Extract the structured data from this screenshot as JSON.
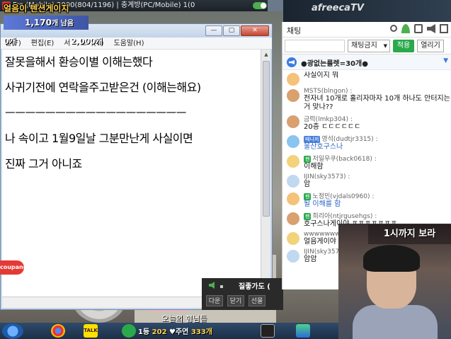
{
  "topbar": {
    "title_text": "Fre  (Mobile) 2000(804/1196) | 충계방(PC/Mobile) 1(0"
  },
  "overlay": {
    "title": "얼음이 텐션게이지",
    "count_main": "1,170",
    "count_suffix": "개 남음",
    "zero_label": "0개",
    "two_thousand_label": "2,000개"
  },
  "notepad": {
    "menu": [
      "일(F)",
      "편집(E)",
      "서",
      "보기(V)",
      "도움말(H)"
    ],
    "lines": [
      "잘못을해서 환승이별 이해는했다",
      "사귀기전에 연락을주고받은건 (이해는해요)",
      "ㅡㅡㅡㅡㅡㅡㅡㅡㅡㅡㅡㅡㅡㅡㅡㅡㅡㅡ",
      "나 속이고 1월9일날 그분만난게 사실이면",
      "진짜 그거 아니죠"
    ],
    "buttons": {
      "minimize": "—",
      "maximize": "▢",
      "close": "✕"
    }
  },
  "coupang": {
    "label": "coupang"
  },
  "player": {
    "quality_label": "질좋가도 (",
    "buttons": [
      "다운",
      "닫기",
      "선물"
    ]
  },
  "chat": {
    "title": "채팅",
    "select_value": "채팅금지",
    "apply_label": "적용",
    "open_label": "열리기",
    "notice": "●광없는룰렛=30개●",
    "messages": [
      {
        "nick": "",
        "text": "사실이지 뭐",
        "avatar": "a1",
        "badge": "",
        "blue": false
      },
      {
        "nick": "MSTS(blngon) :",
        "text": "전자녀 10개로 홀리자마자 10개 하나도 안터지는거 맞나??",
        "avatar": "a2",
        "badge": "",
        "blue": false
      },
      {
        "nick": "금럭(lmkp304) :",
        "text": "20층 ㄷㄷㄷㄷㄷㄷ",
        "avatar": "a2",
        "badge": "",
        "blue": false
      },
      {
        "nick": "영석(dudtjr3315) :",
        "text": "울산호구스나",
        "avatar": "a3",
        "badge": "매니저",
        "blue": true
      },
      {
        "nick": "저일우쿠(back0618) :",
        "text": "이해함",
        "avatar": "a4",
        "badge": "팬",
        "blue": false
      },
      {
        "nick": "IJIN(sky3573) :",
        "text": "암",
        "avatar": "a5",
        "badge": "",
        "blue": false
      },
      {
        "nick": "노정민(vjdals0960) :",
        "text": "될 이해를 함",
        "avatar": "a1",
        "badge": "팬",
        "blue": true
      },
      {
        "nick": "희리아(ntjrgusehgs) :",
        "text": "호구스나게이야 ㅍㅍㅍㅍㅍㅍㅍ",
        "avatar": "a2",
        "badge": "팬",
        "blue": false
      },
      {
        "nick": "wwwwwwww",
        "text": "얼음게이야",
        "avatar": "a4",
        "badge": "",
        "blue": false
      },
      {
        "nick": "IJIN(sky3573) :",
        "text": "암암",
        "avatar": "a5",
        "badge": "",
        "blue": false
      }
    ]
  },
  "cam": {
    "caption": "1시까지 보라"
  },
  "bottom": {
    "title": "오늘의 형님들"
  },
  "taskbar": {
    "talk_label": "TALK",
    "stats": {
      "prefix": "1등",
      "value1": "202",
      "heart_name": "주연",
      "value2": "333개"
    }
  },
  "brand": {
    "afreeca": "afreecaTV"
  }
}
